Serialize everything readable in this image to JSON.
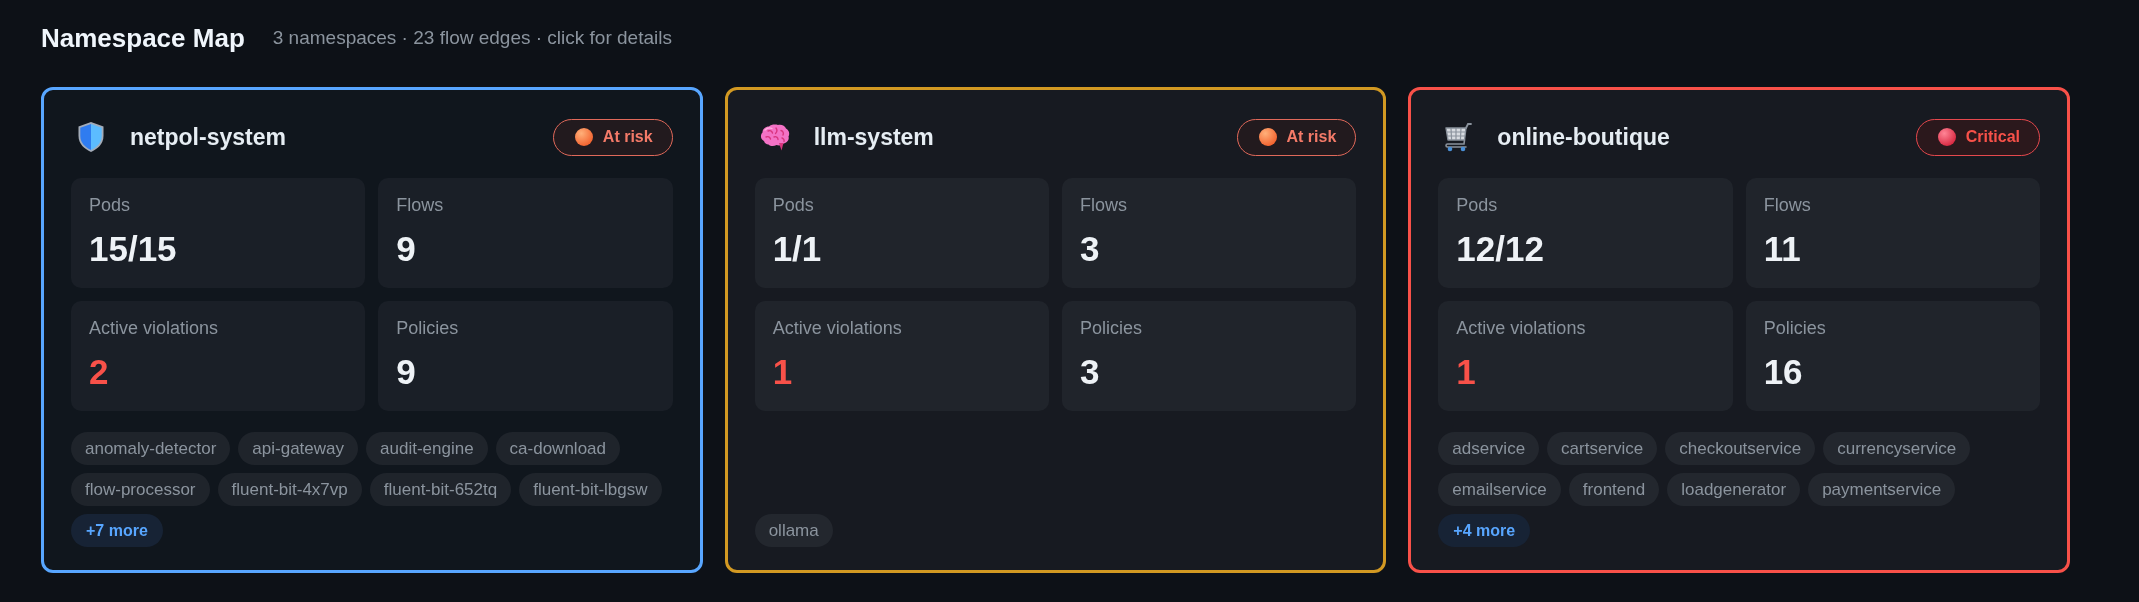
{
  "header": {
    "title": "Namespace Map",
    "summary": "3 namespaces · 23 flow edges · click for details"
  },
  "namespaces": [
    {
      "name": "netpol-system",
      "selected": true,
      "status": {
        "label": "At risk",
        "kind": "at_risk"
      },
      "stats": [
        {
          "label": "Pods",
          "value": "15/15",
          "alert": false
        },
        {
          "label": "Flows",
          "value": "9",
          "alert": false
        },
        {
          "label": "Active violations",
          "value": "2",
          "alert": true
        },
        {
          "label": "Policies",
          "value": "9",
          "alert": false
        }
      ],
      "pods": [
        "anomaly-detector",
        "api-gateway",
        "audit-engine",
        "ca-download",
        "flow-processor",
        "fluent-bit-4x7vp",
        "fluent-bit-652tq",
        "fluent-bit-lbgsw"
      ],
      "more": "+7 more"
    },
    {
      "name": "llm-system",
      "selected": false,
      "status": {
        "label": "At risk",
        "kind": "at_risk"
      },
      "stats": [
        {
          "label": "Pods",
          "value": "1/1",
          "alert": false
        },
        {
          "label": "Flows",
          "value": "3",
          "alert": false
        },
        {
          "label": "Active violations",
          "value": "1",
          "alert": true
        },
        {
          "label": "Policies",
          "value": "3",
          "alert": false
        }
      ],
      "pods": [
        "ollama"
      ]
    },
    {
      "name": "online-boutique",
      "selected": false,
      "status": {
        "label": "Critical",
        "kind": "critical"
      },
      "stats": [
        {
          "label": "Pods",
          "value": "12/12",
          "alert": false
        },
        {
          "label": "Flows",
          "value": "11",
          "alert": false
        },
        {
          "label": "Active violations",
          "value": "1",
          "alert": true
        },
        {
          "label": "Policies",
          "value": "16",
          "alert": false
        }
      ],
      "pods": [
        "adservice",
        "cartservice",
        "checkoutservice",
        "currencyservice",
        "emailservice",
        "frontend",
        "loadgenerator",
        "paymentservice"
      ],
      "more": "+4 more"
    }
  ]
}
